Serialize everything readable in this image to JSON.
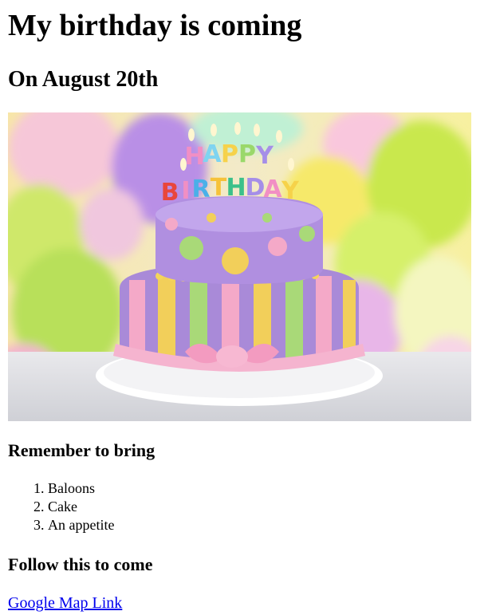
{
  "heading": "My birthday is coming",
  "subheading": "On August 20th",
  "image": {
    "icon": "birthday-cake-photo",
    "cake_topper_top": "HAPPY",
    "cake_topper_bottom": "BIRTHDAY"
  },
  "bring_heading": "Remember to bring",
  "bring_items": [
    "Baloons",
    "Cake",
    "An appetite"
  ],
  "follow_heading": "Follow this to come",
  "map_link": "Google Map Link",
  "colors": {
    "link": "#0000ee"
  }
}
